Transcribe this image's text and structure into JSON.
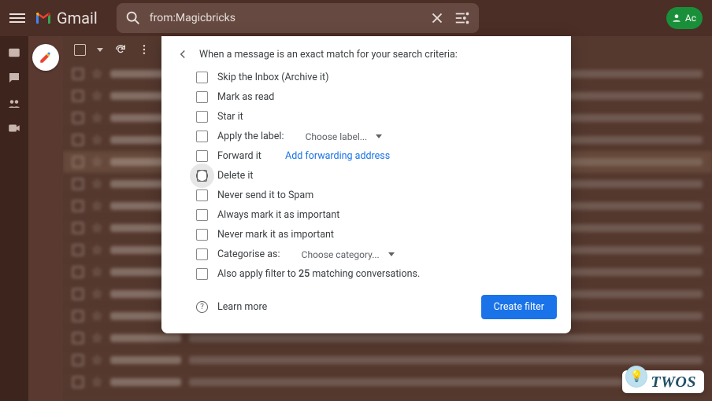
{
  "header": {
    "app_name": "Gmail",
    "search_value": "from:Magicbricks",
    "account_label": "Ac"
  },
  "dialog": {
    "intro": "When a message is an exact match for your search criteria:",
    "skip_inbox": "Skip the Inbox (Archive it)",
    "mark_read": "Mark as read",
    "star_it": "Star it",
    "apply_label": "Apply the label:",
    "apply_label_dd": "Choose label...",
    "forward_it": "Forward it",
    "forward_link": "Add forwarding address",
    "delete_it": "Delete it",
    "never_spam": "Never send it to Spam",
    "always_important": "Always mark it as important",
    "never_important": "Never mark it as important",
    "categorise": "Categorise as:",
    "categorise_dd": "Choose category...",
    "also_apply_pre": "Also apply filter to ",
    "also_apply_count": "25",
    "also_apply_post": " matching conversations.",
    "learn_more": "Learn more",
    "create": "Create filter"
  },
  "watermark": {
    "text": "TWOS"
  }
}
